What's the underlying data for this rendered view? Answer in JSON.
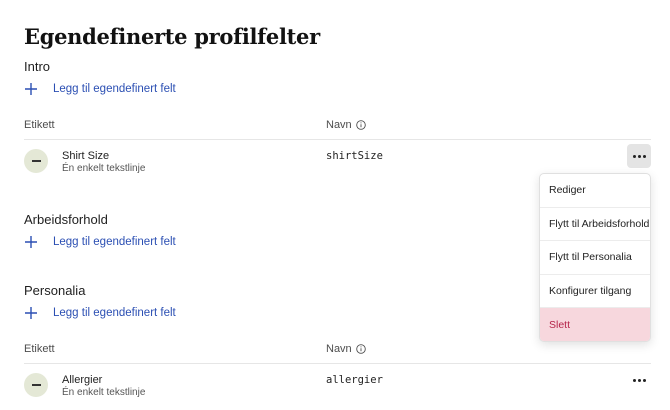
{
  "page": {
    "title": "Egendefinerte profilfelter"
  },
  "add_label": "Legg til egendefinert felt",
  "columns": {
    "label": "Etikett",
    "name": "Navn"
  },
  "sections": [
    {
      "title": "Intro"
    },
    {
      "title": "Arbeidsforhold"
    },
    {
      "title": "Personalia"
    }
  ],
  "rows": [
    {
      "name": "Shirt Size",
      "type": "Én enkelt tekstlinje",
      "key": "shirtSize"
    },
    {
      "name": "Allergier",
      "type": "Én enkelt tekstlinje",
      "key": "allergier"
    }
  ],
  "menu": {
    "items": [
      {
        "label": "Rediger"
      },
      {
        "label": "Flytt til Arbeidsforhold"
      },
      {
        "label": "Flytt til Personalia"
      },
      {
        "label": "Konfigurer tilgang"
      },
      {
        "label": "Slett"
      }
    ]
  },
  "colors": {
    "accent": "#2b4fb3",
    "toggle_bg": "#e4e8d6",
    "danger_bg": "#f7d7dd",
    "danger_text": "#b5254a"
  }
}
